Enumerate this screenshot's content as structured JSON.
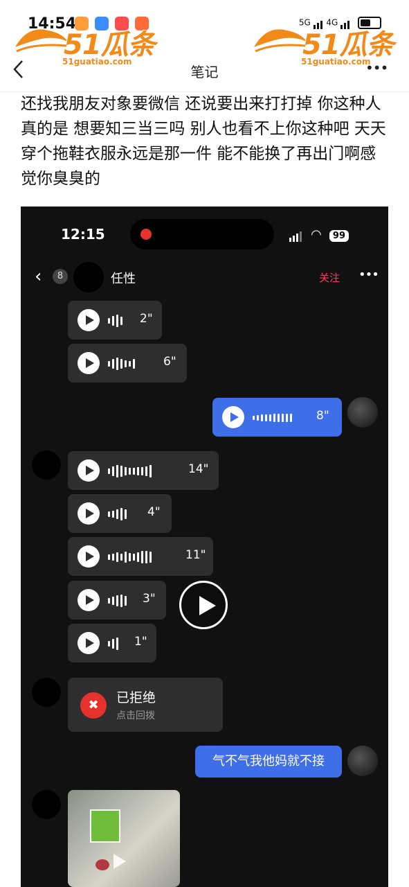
{
  "status_bar": {
    "time": "14:54",
    "network_label_1": "5G",
    "network_label_2": "4G"
  },
  "watermark": {
    "brand": "51瓜条",
    "domain": "51guatiao.com"
  },
  "header": {
    "back_icon": "chevron-left-icon",
    "title": "笔记",
    "more_icon": "more-dots-icon",
    "more_label": "•••"
  },
  "post": {
    "text": "还找我朋友对象要微信 还说要出来打打掉 你这种人真的是 想要知三当三吗 别人也看不上你这种吧 天天穿个拖鞋衣服永远是那一件 能不能换了再出门啊感觉你臭臭的"
  },
  "screenshot": {
    "status": {
      "time": "12:15",
      "battery": "99"
    },
    "chat_header": {
      "unread_count": "8",
      "name": "任性",
      "follow_label": "关注",
      "more_label": "•••"
    },
    "voice_messages": [
      {
        "sender": "other",
        "duration": "2\""
      },
      {
        "sender": "other",
        "duration": "6\""
      },
      {
        "sender": "me",
        "duration": "8\""
      },
      {
        "sender": "other",
        "duration": "14\""
      },
      {
        "sender": "other",
        "duration": "4\""
      },
      {
        "sender": "other",
        "duration": "11\""
      },
      {
        "sender": "other",
        "duration": "3\""
      },
      {
        "sender": "other",
        "duration": "1\""
      }
    ],
    "call": {
      "title": "已拒绝",
      "subtitle": "点击回拨"
    },
    "text_message": "气不气我他妈就不接"
  },
  "colors": {
    "accent_blue": "#3f6fe8",
    "follow_red": "#ff3b5c",
    "watermark_orange": "#f28a1a",
    "chat_bg": "#111111"
  }
}
